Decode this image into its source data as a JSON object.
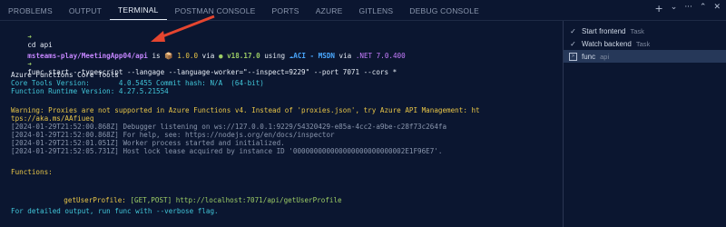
{
  "tabs": [
    {
      "label": "PROBLEMS"
    },
    {
      "label": "OUTPUT"
    },
    {
      "label": "TERMINAL",
      "active": true
    },
    {
      "label": "POSTMAN CONSOLE"
    },
    {
      "label": "PORTS"
    },
    {
      "label": "AZURE"
    },
    {
      "label": "GITLENS"
    },
    {
      "label": "DEBUG CONSOLE"
    }
  ],
  "actions": {
    "add": "+",
    "chevron": "⌄",
    "more": "···",
    "maximize": "⌃",
    "close": "✕"
  },
  "terminal": {
    "l1_prompt": "➜",
    "l1_cmd": "cd api",
    "l2_path": "msteams-play/MeetingApp04/api",
    "l2_is": " is ",
    "l2_pkg": "📦 1.0.0",
    "l2_via": " via ",
    "l2_node": "● v18.17.0",
    "l2_using": " using ",
    "l2_aci": "☁ACI - MSDN",
    "l2_via2": " via ",
    "l2_net": ".NET 7.0.400",
    "l3_prompt": "➜",
    "l3_cmd": "func start --typescript --langage --language-worker=\"--inspect=9229\" --port 7071 --cors *",
    "l4": "Azure Functions Core Tools",
    "l5": "Core Tools Version:       4.0.5455 Commit hash: N/A  (64-bit)",
    "l6": "Function Runtime Version: 4.27.5.21554",
    "l7": "Warning: Proxies are not supported in Azure Functions v4. Instead of 'proxies.json', try Azure API Management: ht",
    "l8": "tps://aka.ms/AAfiueq",
    "l9": "[2024-01-29T21:52:00.868Z] Debugger listening on ws://127.0.0.1:9229/54320429-e85a-4cc2-a9be-c28f73c264fa",
    "l10": "[2024-01-29T21:52:00.868Z] For help, see: https://nodejs.org/en/docs/inspector",
    "l11": "[2024-01-29T21:52:01.051Z] Worker process started and initialized.",
    "l12": "[2024-01-29T21:52:05.731Z] Host lock lease acquired by instance ID '000000000000000000000000002E1F96E7'.",
    "l13": "Functions:",
    "l14_name": "getUserProfile:",
    "l14_rest": " [GET,POST] http://localhost:7071/api/getUserProfile",
    "l15": "For detailed output, run func with --verbose flag."
  },
  "tasks": [
    {
      "label": "Start frontend",
      "sub": "Task",
      "icon": "check-icon"
    },
    {
      "label": "Watch backend",
      "sub": "Task",
      "icon": "check-icon"
    },
    {
      "label": "func",
      "sub": "api",
      "icon": "terminal-icon",
      "active": true
    }
  ]
}
